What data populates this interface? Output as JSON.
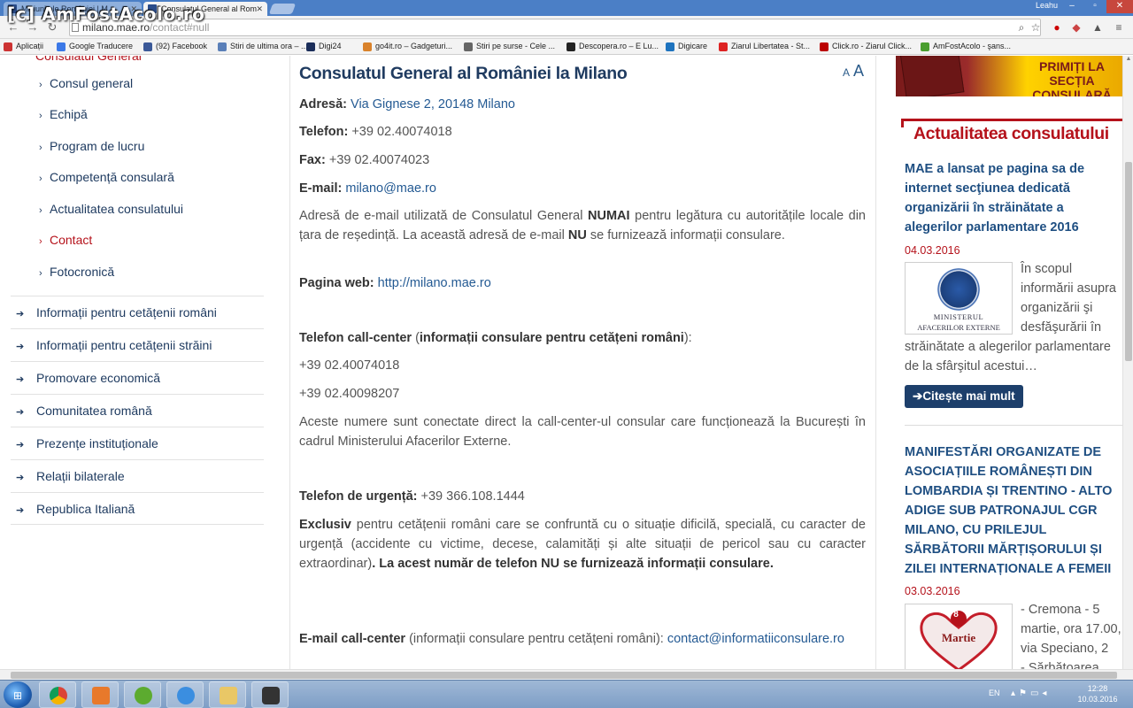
{
  "watermark": "[c] AmFostAcolo.ro",
  "browser": {
    "tabs": [
      {
        "label": "Misiuni ale României | M"
      },
      {
        "label": "Consulatul General al Rom"
      }
    ],
    "user": "Leahu",
    "url_main": "milano.mae.ro",
    "url_rest": "/contact#null",
    "bookmarks": [
      {
        "label": "Aplicații",
        "color": "#c33"
      },
      {
        "label": "Google Traducere",
        "color": "#3b78e7"
      },
      {
        "label": "(92) Facebook",
        "color": "#3b5998"
      },
      {
        "label": "Stiri de ultima ora – ...",
        "color": "#5a7fb8"
      },
      {
        "label": "Digi24",
        "color": "#1b2e5a"
      },
      {
        "label": "go4it.ro – Gadgeturi...",
        "color": "#d9822b"
      },
      {
        "label": "Stiri pe surse - Cele ...",
        "color": "#666"
      },
      {
        "label": "Descopera.ro – E Lu...",
        "color": "#222"
      },
      {
        "label": "Digicare",
        "color": "#1e73be"
      },
      {
        "label": "Ziarul Libertatea - St...",
        "color": "#d22"
      },
      {
        "label": "Click.ro - Ziarul Click...",
        "color": "#b00"
      },
      {
        "label": "AmFostAcolo - şans...",
        "color": "#4a9e2f"
      }
    ]
  },
  "leftnav": {
    "parent_cut": "Consulatul General",
    "sub_items": [
      {
        "label": "Consul general"
      },
      {
        "label": "Echipă"
      },
      {
        "label": "Program de lucru"
      },
      {
        "label": "Competență consulară"
      },
      {
        "label": "Actualitatea consulatului"
      },
      {
        "label": "Contact"
      },
      {
        "label": "Fotocronică"
      }
    ],
    "main_items": [
      {
        "label": "Informații pentru cetățenii români"
      },
      {
        "label": "Informații pentru cetățenii străini"
      },
      {
        "label": "Promovare economică"
      },
      {
        "label": "Comunitatea română"
      },
      {
        "label": "Prezențe instituționale"
      },
      {
        "label": "Relații bilaterale"
      },
      {
        "label": "Republica Italiană"
      }
    ]
  },
  "content": {
    "title": "Consulatul General al României la Milano",
    "font_small": "A",
    "font_large": "A",
    "address_label": "Adresă:",
    "address_value": "Via Gignese 2, 20148 Milano",
    "phone_label": "Telefon:",
    "phone_value": "+39 02.40074018",
    "fax_label": "Fax:",
    "fax_value": "+39 02.40074023",
    "email_label": "E-mail:",
    "email_value": "milano@mae.ro",
    "email_note_1": "Adresă de e-mail utilizată de Consulatul General ",
    "email_note_numai": "NUMAI",
    "email_note_2": " pentru legătura cu autoritățile locale din țara de reședință. La această adresă de e-mail ",
    "email_note_nu": "NU",
    "email_note_3": " se furnizează informații consulare.",
    "web_label": "Pagina web:",
    "web_value": "http://milano.mae.ro",
    "callcenter_label": "Telefon call-center",
    "callcenter_paren_open": " (",
    "callcenter_bold": "informații consulare pentru cetățeni români",
    "callcenter_paren_close": "):",
    "callcenter_phone_1": "+39 02.40074018",
    "callcenter_phone_2": "+39 02.40098207",
    "callcenter_note": "Aceste numere sunt conectate direct la call-center-ul consular care funcționează la București în cadrul Ministerului Afacerilor Externe.",
    "urgent_label": "Telefon de urgență:",
    "urgent_value": "+39 366.108.1444",
    "urgent_exclusiv": "Exclusiv",
    "urgent_note": " pentru cetățenii români care se confruntă cu o situație dificilă, specială, cu caracter de urgență (accidente cu victime, decese, calamități și alte situații de pericol sau cu caracter extraordinar)",
    "urgent_dot": ". ",
    "urgent_warning": "La acest număr de telefon NU se furnizează informații consulare.",
    "cc_email_label": "E-mail call-center",
    "cc_email_paren": " (informații consulare pentru cetățeni români): ",
    "cc_email_value": "contact@informatiiconsulare.ro"
  },
  "rightcol": {
    "banner_text": "PRIMIȚI LA SECȚIA CONSULARĂ",
    "heading": "Actualitatea consulatului",
    "news": [
      {
        "title_lines": [
          "MAE a lansat pe pagina sa de",
          "internet secţiunea dedicată",
          "organizării în străinătate a",
          "alegerilor parlamentare 2016"
        ],
        "date": "04.03.2016",
        "thumb_t1": "MINISTERUL",
        "thumb_t2": "AFACERILOR EXTERNE",
        "text_side": [
          "În scopul",
          "informării asupra",
          "organizării şi",
          "desfăşurării în"
        ],
        "text_full": [
          "străinătate a alegerilor parlamentare",
          "de la sfârşitul acestui…"
        ]
      },
      {
        "title_lines": [
          "MANIFESTĂRI ORGANIZATE DE",
          "ASOCIAȚIILE ROMÂNEȘTI DIN",
          "LOMBARDIA ȘI TRENTINO - ALTO",
          "ADIGE SUB PATRONAJUL CGR",
          "MILANO, CU PRILEJUL",
          "SĂRBĂTORII MĂRȚIȘORULUI ȘI",
          "ZILEI INTERNAȚIONALE A FEMEII"
        ],
        "date": "03.03.2016",
        "thumb_t1": "8",
        "thumb_t2": "Martie",
        "text_side": [
          "- Cremona - 5",
          "martie, ora 17.00,",
          "via Speciano, 2",
          "- Sărbătoarea"
        ]
      }
    ],
    "readmore": "Citește mai mult"
  },
  "taskbar": {
    "lang": "EN",
    "time": "12:28",
    "date": "10.03.2016"
  }
}
